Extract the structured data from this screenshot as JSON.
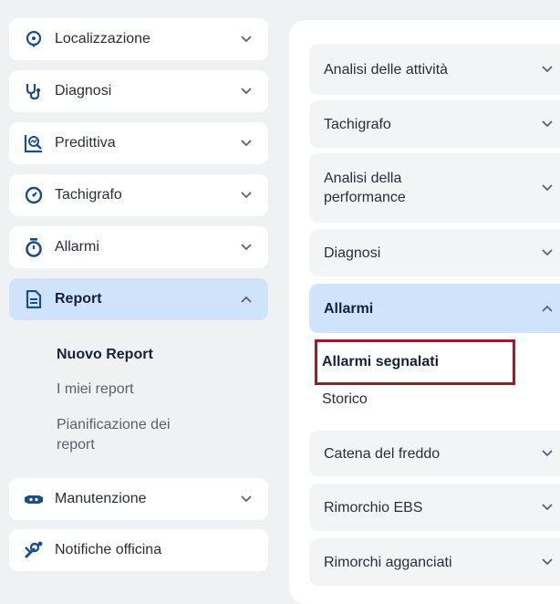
{
  "sidebar": {
    "items": [
      {
        "label": "Localizzazione",
        "icon": "location-pin-icon"
      },
      {
        "label": "Diagnosi",
        "icon": "stethoscope-icon"
      },
      {
        "label": "Predittiva",
        "icon": "predictive-chart-icon"
      },
      {
        "label": "Tachigrafo",
        "icon": "tachograph-icon"
      },
      {
        "label": "Allarmi",
        "icon": "stopwatch-icon"
      },
      {
        "label": "Report",
        "icon": "document-icon",
        "expanded": true
      },
      {
        "label": "Manutenzione",
        "icon": "maintenance-icon"
      },
      {
        "label": "Notifiche officina",
        "icon": "workshop-icon"
      }
    ],
    "report_sub": [
      {
        "label": "Nuovo Report",
        "current": true
      },
      {
        "label": "I miei report"
      },
      {
        "label": "Pianificazione dei\nreport"
      }
    ]
  },
  "categories": {
    "items": [
      {
        "label": "Analisi delle attività"
      },
      {
        "label": "Tachigrafo"
      },
      {
        "label": "Analisi della\nperformance"
      },
      {
        "label": "Diagnosi"
      },
      {
        "label": "Allarmi",
        "expanded": true
      },
      {
        "label": "Catena del freddo"
      },
      {
        "label": "Rimorchio EBS"
      },
      {
        "label": "Rimorchi agganciati"
      }
    ],
    "allarmi_sub": [
      {
        "label": "Allarmi segnalati",
        "current": true
      },
      {
        "label": "Storico"
      }
    ]
  },
  "colors": {
    "accent_active": "#cfe3fb",
    "icon_blue": "#1c4e86",
    "highlight_border": "#9b1c2a"
  }
}
